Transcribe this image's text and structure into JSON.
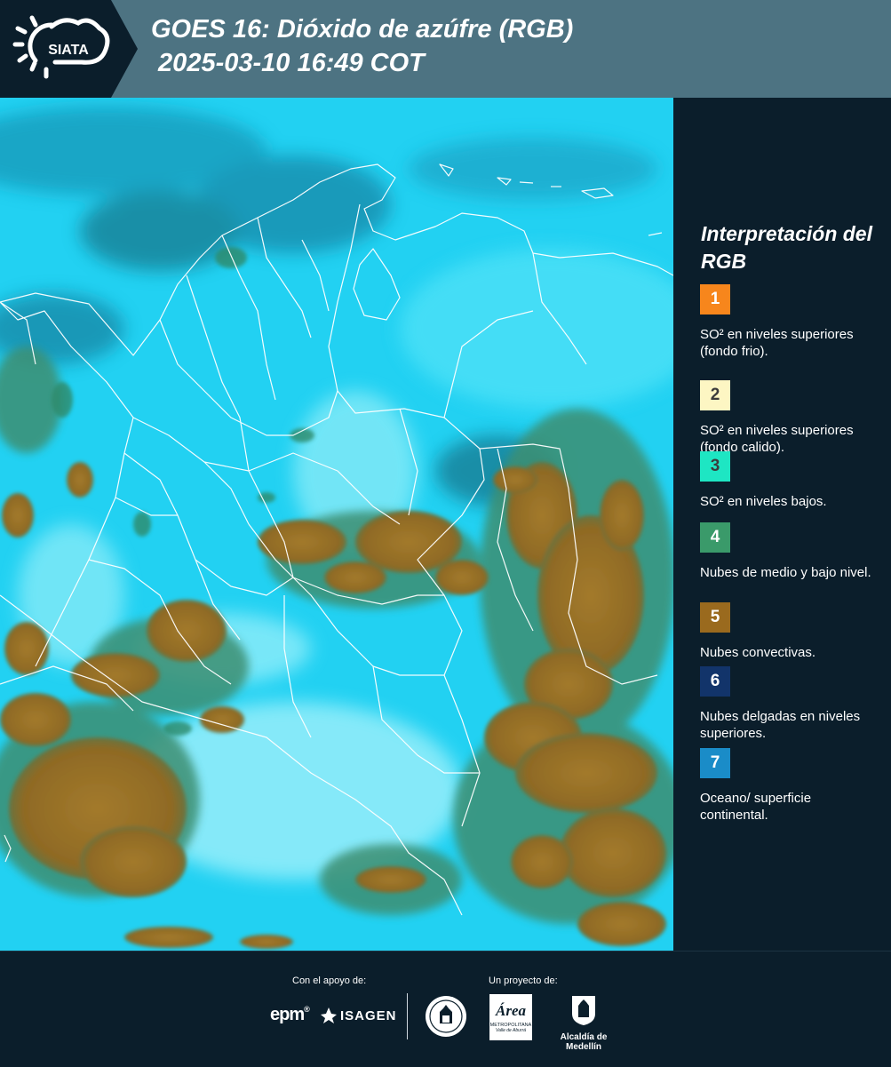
{
  "header": {
    "logo_text": "SIATA",
    "title_line1": "GOES 16: Dióxido de azúfre (RGB)",
    "title_line2": " 2025-03-10 16:49 COT"
  },
  "legend": {
    "title": "Interpretación del RGB",
    "items": [
      {
        "number": "1",
        "label": "SO² en niveles superiores (fondo frio).",
        "color": "#f7861c",
        "text_color": "#ffffff"
      },
      {
        "number": "2",
        "label": "SO² en niveles superiores (fondo calido).",
        "color": "#fdf6c3",
        "text_color": "#3b3b3b"
      },
      {
        "number": "3",
        "label": "SO² en niveles bajos.",
        "color": "#1ee6c3",
        "text_color": "#3b3b3b"
      },
      {
        "number": "4",
        "label": "Nubes de medio y bajo nivel.",
        "color": "#3a9a6a",
        "text_color": "#ffffff"
      },
      {
        "number": "5",
        "label": "Nubes convectivas.",
        "color": "#9a6a1e",
        "text_color": "#ffffff"
      },
      {
        "number": "6",
        "label": "Nubes delgadas en niveles superiores.",
        "color": "#12346a",
        "text_color": "#ffffff"
      },
      {
        "number": "7",
        "label": "Oceano/ superficie continental.",
        "color": "#1a8cc8",
        "text_color": "#ffffff"
      }
    ]
  },
  "footer": {
    "support_label": "Con el apoyo de:",
    "project_label": "Un proyecto de:",
    "sponsor_epm": "epm",
    "sponsor_isagen": "ISAGEN",
    "area_logo_word": "Área",
    "area_logo_sub1": "METROPOLITANA",
    "area_logo_sub2": "Valle de Aburrá",
    "alcaldia_label": "Alcaldía de Medellín"
  },
  "colors": {
    "header_bg": "#4d7382",
    "panel_bg": "#0b1e2b",
    "map_cyan": "#22d1f2",
    "cloud_brown": "#9a7228",
    "cloud_green": "#3f8f74",
    "border_white": "#ffffff"
  }
}
